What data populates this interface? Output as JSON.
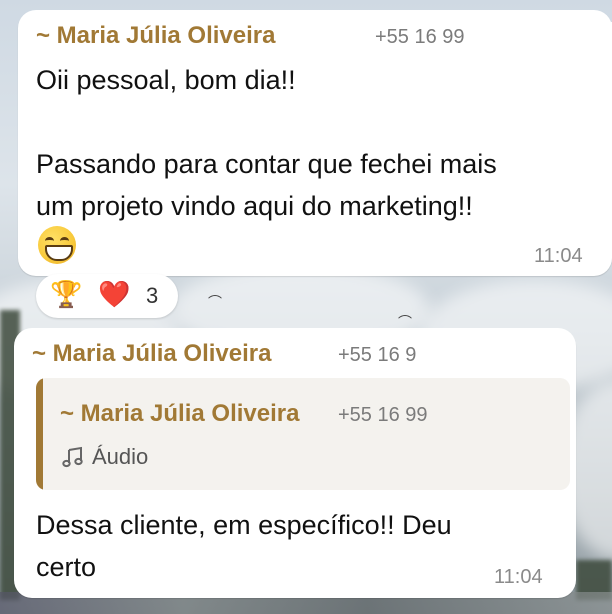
{
  "messages": [
    {
      "sender": "~ Maria Júlia Oliveira",
      "phone": "+55 16 99",
      "text": "Oii pessoal, bom dia!!\n\nPassando para contar que fechei mais\num projeto vindo aqui do marketing!!",
      "emoji": "grinning-face-with-smiling-eyes",
      "time": "11:04",
      "reactions": {
        "icons": [
          "🏆",
          "❤️"
        ],
        "count": "3"
      }
    },
    {
      "sender": "~ Maria Júlia Oliveira",
      "phone": "+55 16 9",
      "quoted": {
        "sender": "~ Maria Júlia Oliveira",
        "phone": "+55 16 99",
        "icon": "music-note-icon",
        "label": "Áudio"
      },
      "text": "Dessa cliente, em específico!! Deu\ncerto",
      "time": "11:04"
    }
  ],
  "colors": {
    "sender_name": "#a17935",
    "bubble": "#ffffff",
    "quote_background": "#f4f2ee",
    "timestamp": "#8a8a8a"
  }
}
